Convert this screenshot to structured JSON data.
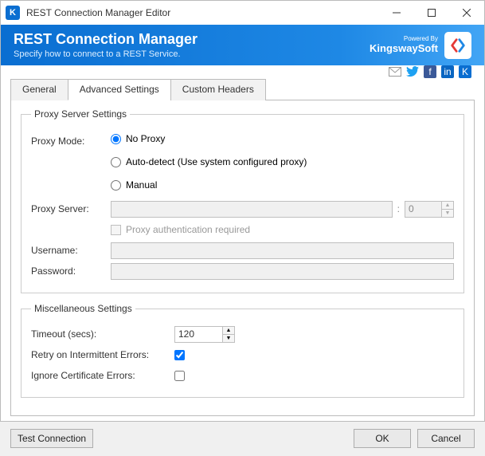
{
  "window": {
    "title": "REST Connection Manager Editor"
  },
  "banner": {
    "title": "REST Connection Manager",
    "subtitle": "Specify how to connect to a REST Service.",
    "powered_prefix": "Powered By",
    "brand": "KingswaySoft"
  },
  "tabs": {
    "general": "General",
    "advanced": "Advanced Settings",
    "custom": "Custom Headers"
  },
  "proxy": {
    "legend": "Proxy Server Settings",
    "mode_label": "Proxy Mode:",
    "opt_noproxy": "No Proxy",
    "opt_autodetect": "Auto-detect (Use system configured proxy)",
    "opt_manual": "Manual",
    "server_label": "Proxy Server:",
    "server_value": "",
    "port_value": "0",
    "auth_required_label": "Proxy authentication required",
    "username_label": "Username:",
    "username_value": "",
    "password_label": "Password:",
    "password_value": ""
  },
  "misc": {
    "legend": "Miscellaneous Settings",
    "timeout_label": "Timeout (secs):",
    "timeout_value": "120",
    "retry_label": "Retry on Intermittent Errors:",
    "ignore_cert_label": "Ignore Certificate Errors:"
  },
  "footer": {
    "test": "Test Connection",
    "ok": "OK",
    "cancel": "Cancel"
  }
}
